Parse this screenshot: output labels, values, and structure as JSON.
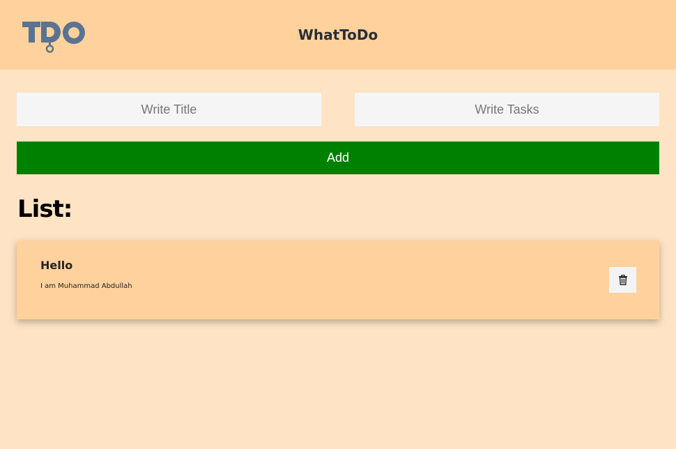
{
  "header": {
    "logo_text": "TDO",
    "title": "WhatToDo"
  },
  "form": {
    "title_placeholder": "Write Title",
    "tasks_placeholder": "Write Tasks",
    "add_label": "Add"
  },
  "list": {
    "heading": "List:",
    "items": [
      {
        "title": "Hello",
        "description": "I am Muhammad Abdullah",
        "delete_icon": "trash-icon"
      }
    ]
  },
  "colors": {
    "header_bg": "#ffd29d",
    "page_bg": "#fee4c4",
    "add_button": "#008000",
    "logo": "#5a7391"
  }
}
